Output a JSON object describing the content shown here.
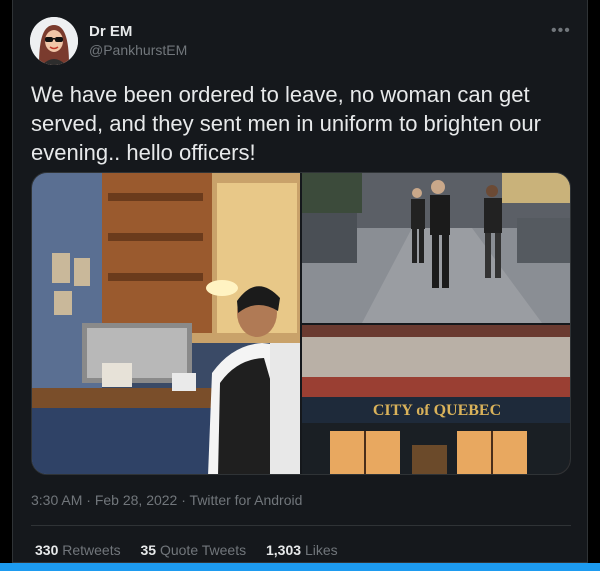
{
  "author": {
    "name": "Dr EM",
    "handle": "@PankhurstEM",
    "avatar_icon": "avatar-illustration"
  },
  "tweet": {
    "text": "We have been ordered to leave, no woman can get served, and they sent men in uniform to brighten our evening..  hello officers!"
  },
  "media": {
    "photo_3_sign": "CITY of QUEBEC"
  },
  "meta": {
    "time": "3:30 AM",
    "separator": " · ",
    "date": "Feb 28, 2022",
    "source": "Twitter for Android"
  },
  "stats": {
    "retweets_count": "330",
    "retweets_label": "Retweets",
    "quotes_count": "35",
    "quotes_label": "Quote Tweets",
    "likes_count": "1,303",
    "likes_label": "Likes"
  },
  "colors": {
    "background": "#000000",
    "card": "#15181c",
    "text": "#e7e9ea",
    "muted": "#71767b",
    "accent": "#1d9bf0"
  }
}
